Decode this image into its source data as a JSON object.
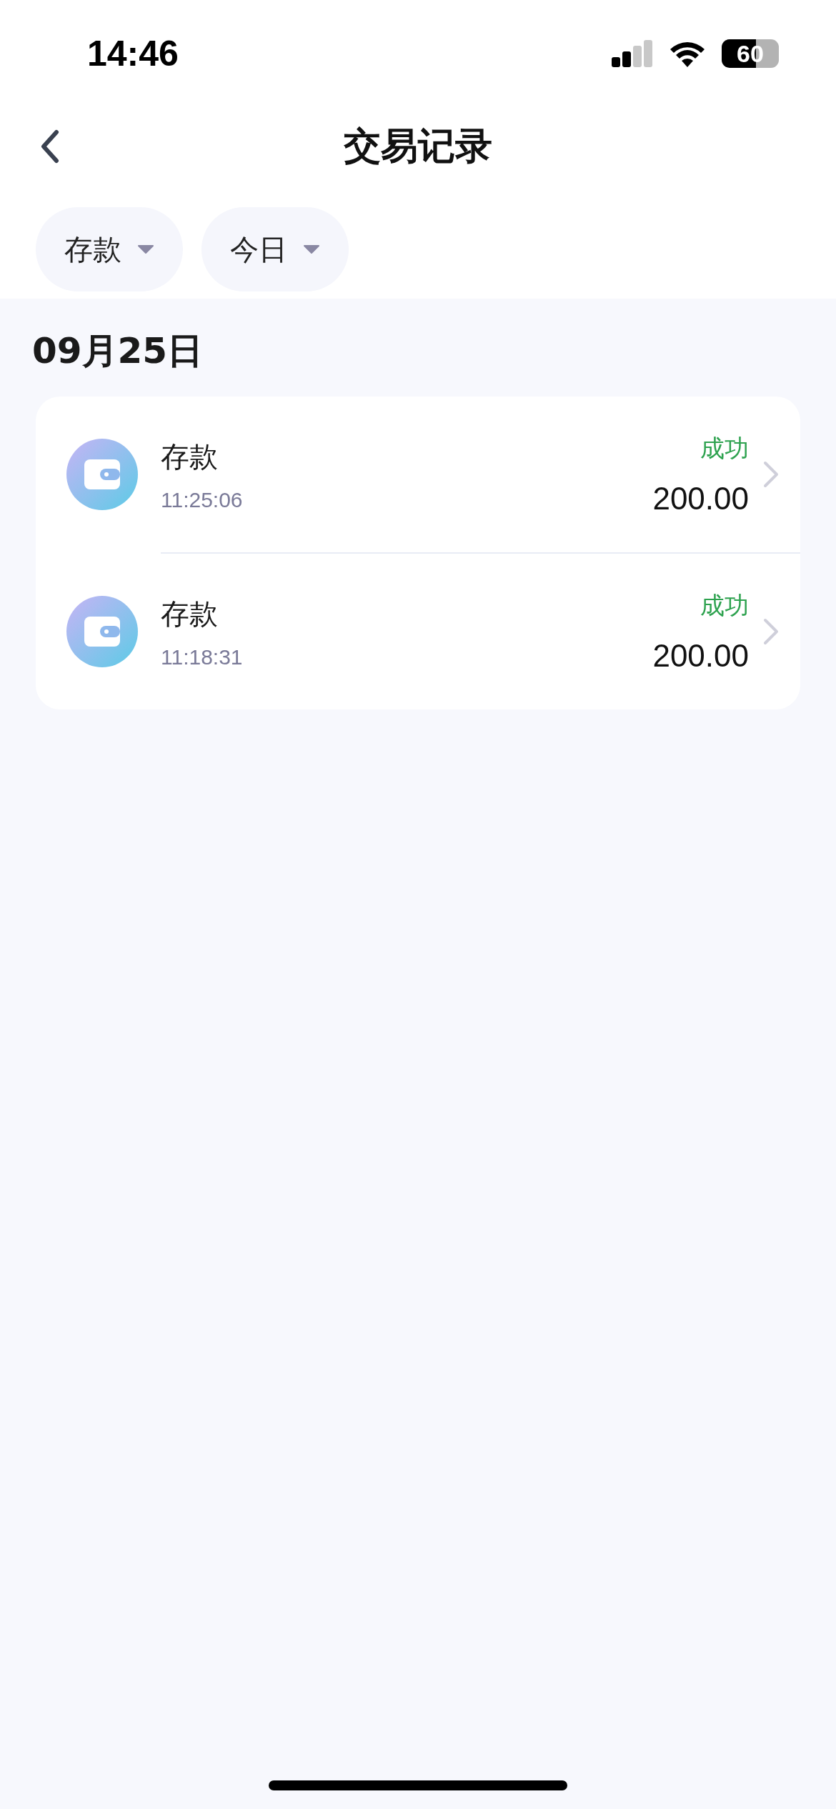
{
  "status_bar": {
    "time": "14:46",
    "battery": "60"
  },
  "header": {
    "title": "交易记录"
  },
  "filters": [
    {
      "label": "存款"
    },
    {
      "label": "今日"
    }
  ],
  "groups": [
    {
      "date": "09月25日",
      "transactions": [
        {
          "title": "存款",
          "time": "11:25:06",
          "status": {
            "text": "成功",
            "kind": "success"
          },
          "amount": "200.00"
        },
        {
          "title": "存款",
          "time": "11:18:31",
          "status": {
            "text": "成功",
            "kind": "success"
          },
          "amount": "200.00"
        }
      ]
    }
  ]
}
